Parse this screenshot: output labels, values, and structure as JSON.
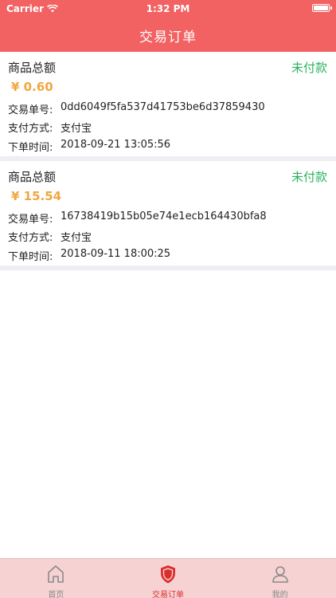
{
  "status_bar": {
    "carrier": "Carrier",
    "time": "1:32 PM"
  },
  "nav": {
    "title": "交易订单"
  },
  "orders": [
    {
      "title": "商品总额",
      "status": "未付款",
      "amount": "¥ 0.60",
      "order_no_label": "交易单号:",
      "order_no": "0dd6049f5fa537d41753be6d37859430",
      "pay_method_label": "支付方式:",
      "pay_method": "支付宝",
      "order_time_label": "下单时间:",
      "order_time": "2018-09-21 13:05:56"
    },
    {
      "title": "商品总额",
      "status": "未付款",
      "amount": "¥ 15.54",
      "order_no_label": "交易单号:",
      "order_no": "16738419b15b05e74e1ecb164430bfa8",
      "pay_method_label": "支付方式:",
      "pay_method": "支付宝",
      "order_time_label": "下单时间:",
      "order_time": "2018-09-11 18:00:25"
    }
  ],
  "tabs": [
    {
      "label": "首页",
      "icon": "home-icon",
      "active": false
    },
    {
      "label": "交易订单",
      "icon": "shield-icon",
      "active": true
    },
    {
      "label": "我的",
      "icon": "user-icon",
      "active": false
    }
  ],
  "colors": {
    "header": "#f26262",
    "status_unpaid": "#2bb35c",
    "amount": "#f2a640",
    "tab_bar": "#f7d2d2",
    "tab_active": "#d9302f"
  }
}
